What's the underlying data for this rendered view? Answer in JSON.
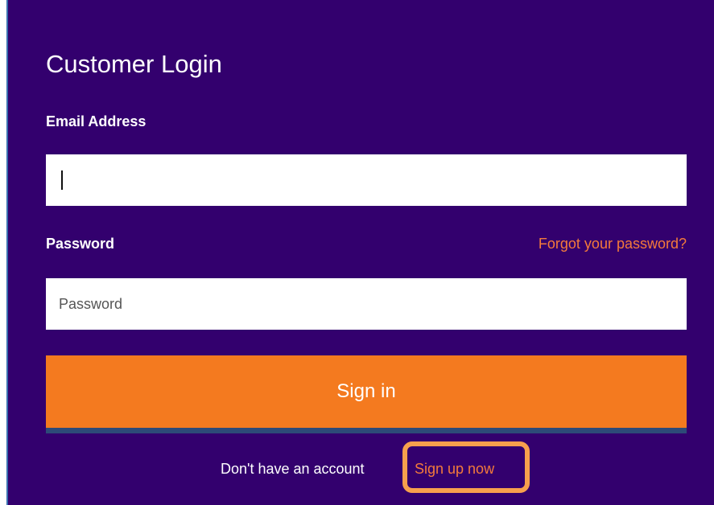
{
  "login": {
    "title": "Customer Login",
    "email_label": "Email Address",
    "email_value": "",
    "password_label": "Password",
    "password_placeholder": "Password",
    "forgot_link": "Forgot your password?",
    "signin_label": "Sign in",
    "signup_prompt": "Don't have an account",
    "signup_link": "Sign up now"
  },
  "colors": {
    "panel_background": "#33006e",
    "accent_orange": "#f47a1f",
    "link_orange": "#f47a3b",
    "highlight_orange": "#f7a04d"
  }
}
